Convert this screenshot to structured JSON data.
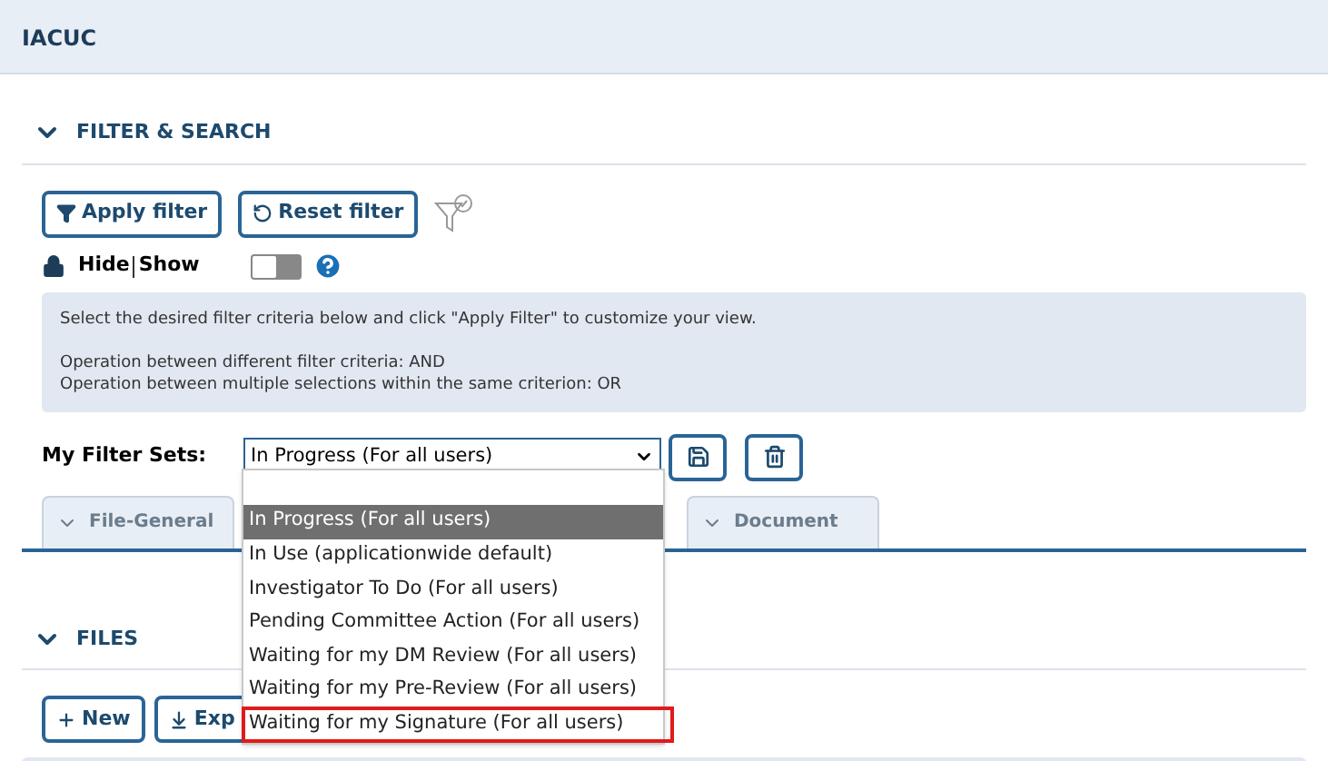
{
  "header": {
    "title": "IACUC"
  },
  "filter_section": {
    "title": "FILTER & SEARCH",
    "expanded": true,
    "buttons": [
      {
        "kind": "apply",
        "label": "Apply filter"
      },
      {
        "kind": "reset",
        "label": "Reset filter"
      }
    ],
    "hide_show": {
      "hide": "Hide",
      "show": "Show",
      "on": false
    },
    "info": [
      "Select the desired filter criteria below and click \"Apply Filter\" to customize your view.",
      "Operation between different filter criteria: AND",
      "Operation between multiple selections within the same criterion: OR"
    ],
    "filter_sets": {
      "label": "My Filter Sets:",
      "value": "In Progress (For all users)",
      "open": true,
      "options": [
        {
          "label": "In Progress (For all users)",
          "selected": true,
          "outlined": false
        },
        {
          "label": "In Use (applicationwide default)",
          "selected": false,
          "outlined": false
        },
        {
          "label": "Investigator To Do (For all users)",
          "selected": false,
          "outlined": false
        },
        {
          "label": "Pending Committee Action (For all users)",
          "selected": false,
          "outlined": false
        },
        {
          "label": "Waiting for my DM Review (For all users)",
          "selected": false,
          "outlined": false
        },
        {
          "label": "Waiting for my Pre-Review (For all users)",
          "selected": false,
          "outlined": false
        },
        {
          "label": "Waiting for my Signature (For all users)",
          "selected": false,
          "outlined": true
        }
      ]
    },
    "tabs": [
      {
        "label": "File-General",
        "expanded": false
      },
      {
        "label": "Document",
        "expanded": false
      }
    ]
  },
  "files_section": {
    "title": "FILES",
    "expanded": true,
    "buttons": [
      {
        "kind": "new",
        "label": "New"
      },
      {
        "kind": "export",
        "label": "Exp"
      }
    ]
  }
}
